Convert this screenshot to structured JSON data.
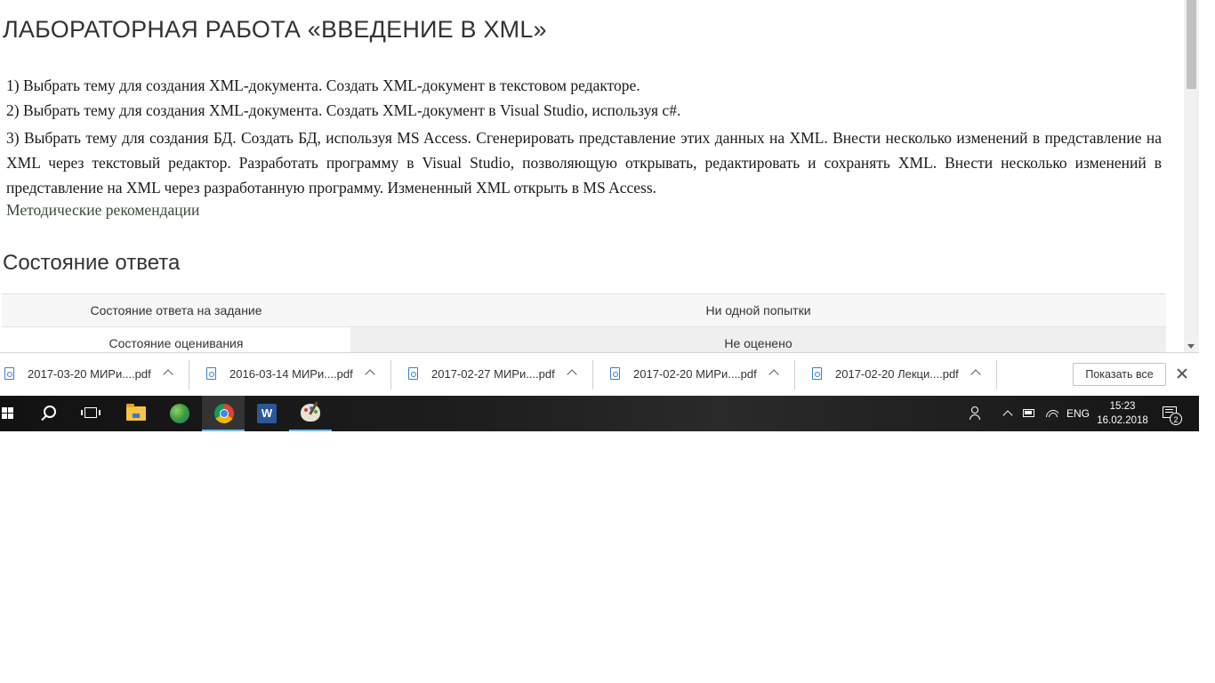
{
  "page": {
    "title": "ЛАБОРАТОРНАЯ РАБОТА «ВВЕДЕНИЕ В XML»",
    "tasks": [
      "1) Выбрать тему для создания XML-документа. Создать XML-документ в текстовом редакторе.",
      "2) Выбрать тему для создания XML-документа. Создать XML-документ в Visual Studio, используя c#.",
      "3) Выбрать тему для создания БД. Создать БД, используя MS Access. Сгенерировать представление этих данных на XML. Внести несколько изменений в представление на XML через текстовый редактор. Разработать программу в Visual Studio, позволяющую открывать, редактировать и сохранять XML. Внести несколько изменений в представление на XML через разработанную программу. Измененный XML открыть в MS Access."
    ],
    "methodics_link": "Методические рекомендации",
    "section_heading": "Состояние ответа",
    "status_table": [
      {
        "label": "Состояние ответа на задание",
        "value": "Ни одной попытки"
      },
      {
        "label": "Состояние оценивания",
        "value": "Не оценено"
      }
    ]
  },
  "downloads": {
    "items": [
      {
        "name": "2017-03-20 МИРи....pdf",
        "icon": "pdf-file-icon"
      },
      {
        "name": "2016-03-14 МИРи....pdf",
        "icon": "pdf-file-icon"
      },
      {
        "name": "2017-02-27 МИРи....pdf",
        "icon": "pdf-file-icon"
      },
      {
        "name": "2017-02-20 МИРи....pdf",
        "icon": "pdf-file-icon"
      },
      {
        "name": "2017-02-20 Лекци....pdf",
        "icon": "pdf-file-icon"
      }
    ],
    "show_all_label": "Показать все",
    "close_icon": "close-icon"
  },
  "taskbar": {
    "apps": [
      {
        "name": "start",
        "icon": "windows-start-icon"
      },
      {
        "name": "search",
        "icon": "search-icon"
      },
      {
        "name": "task-view",
        "icon": "task-view-icon"
      },
      {
        "name": "file-explorer",
        "icon": "folder-icon"
      },
      {
        "name": "browser-globe",
        "icon": "globe-icon"
      },
      {
        "name": "chrome",
        "icon": "chrome-icon",
        "active": true
      },
      {
        "name": "word",
        "icon": "word-icon",
        "glyph": "W"
      },
      {
        "name": "paint",
        "icon": "paint-icon"
      }
    ],
    "tray": {
      "language": "ENG",
      "time": "15:23",
      "date": "16.02.2018",
      "notification_count": "2"
    }
  },
  "colors": {
    "accent_underline": "#76b9ed",
    "file_icon": "#3b7fcf",
    "link": "#3a4a3a"
  }
}
